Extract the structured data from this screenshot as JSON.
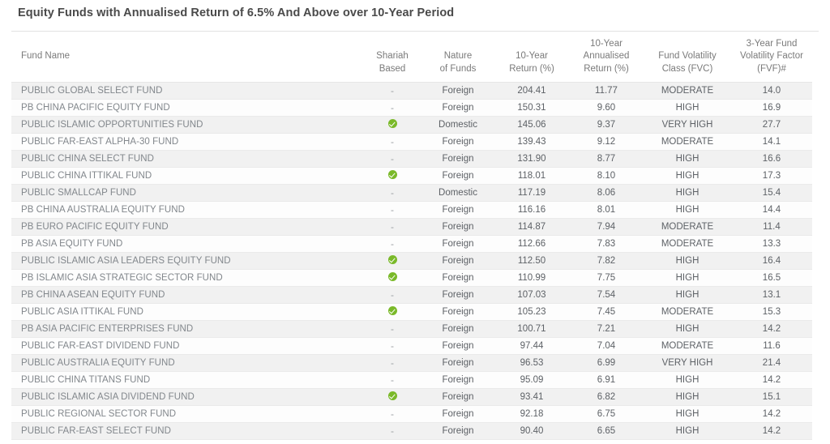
{
  "page": {
    "title": "Equity Funds with Annualised Return of 6.5% And Above over 10-Year Period"
  },
  "table": {
    "columns": [
      {
        "key": "name",
        "label": "Fund Name"
      },
      {
        "key": "shariah",
        "label": "Shariah\nBased"
      },
      {
        "key": "nature",
        "label": "Nature\nof Funds"
      },
      {
        "key": "ret10",
        "label": "10-Year\nReturn (%)"
      },
      {
        "key": "ann10",
        "label": "10-Year\nAnnualised\nReturn (%)"
      },
      {
        "key": "fvc",
        "label": "Fund Volatility\nClass (FVC)"
      },
      {
        "key": "fvf",
        "label": "3-Year Fund\nVolatility Factor\n(FVF)#"
      }
    ],
    "header": {
      "fund_name": "Fund Name",
      "shariah_line1": "Shariah",
      "shariah_line2": "Based",
      "nature_line1": "Nature",
      "nature_line2": "of Funds",
      "ret10_line1": "10-Year",
      "ret10_line2": "Return (%)",
      "ann10_line1": "10-Year",
      "ann10_line2": "Annualised",
      "ann10_line3": "Return (%)",
      "fvc_line1": "Fund Volatility",
      "fvc_line2": "Class (FVC)",
      "fvf_line1": "3-Year Fund",
      "fvf_line2": "Volatility Factor",
      "fvf_line3": "(FVF)#"
    },
    "icons": {
      "shariah_yes": "check-circle-icon",
      "shariah_no": "-"
    },
    "colors": {
      "check_green": "#7ab929",
      "row_odd": "#f1f1f1",
      "row_even": "#fdfdfd",
      "header_text": "#7a7a7a",
      "title_text": "#4a4a4a"
    },
    "rows": [
      {
        "name": "PUBLIC GLOBAL SELECT FUND",
        "shariah": false,
        "nature": "Foreign",
        "ret10": "204.41",
        "ann10": "11.77",
        "fvc": "MODERATE",
        "fvf": "14.0"
      },
      {
        "name": "PB CHINA PACIFIC EQUITY FUND",
        "shariah": false,
        "nature": "Foreign",
        "ret10": "150.31",
        "ann10": "9.60",
        "fvc": "HIGH",
        "fvf": "16.9"
      },
      {
        "name": "PUBLIC ISLAMIC OPPORTUNITIES FUND",
        "shariah": true,
        "nature": "Domestic",
        "ret10": "145.06",
        "ann10": "9.37",
        "fvc": "VERY HIGH",
        "fvf": "27.7"
      },
      {
        "name": "PUBLIC FAR-EAST ALPHA-30 FUND",
        "shariah": false,
        "nature": "Foreign",
        "ret10": "139.43",
        "ann10": "9.12",
        "fvc": "MODERATE",
        "fvf": "14.1"
      },
      {
        "name": "PUBLIC CHINA SELECT FUND",
        "shariah": false,
        "nature": "Foreign",
        "ret10": "131.90",
        "ann10": "8.77",
        "fvc": "HIGH",
        "fvf": "16.6"
      },
      {
        "name": "PUBLIC CHINA ITTIKAL FUND",
        "shariah": true,
        "nature": "Foreign",
        "ret10": "118.01",
        "ann10": "8.10",
        "fvc": "HIGH",
        "fvf": "17.3"
      },
      {
        "name": "PUBLIC SMALLCAP FUND",
        "shariah": false,
        "nature": "Domestic",
        "ret10": "117.19",
        "ann10": "8.06",
        "fvc": "HIGH",
        "fvf": "15.4"
      },
      {
        "name": "PB CHINA AUSTRALIA EQUITY FUND",
        "shariah": false,
        "nature": "Foreign",
        "ret10": "116.16",
        "ann10": "8.01",
        "fvc": "HIGH",
        "fvf": "14.4"
      },
      {
        "name": "PB EURO PACIFIC EQUITY FUND",
        "shariah": false,
        "nature": "Foreign",
        "ret10": "114.87",
        "ann10": "7.94",
        "fvc": "MODERATE",
        "fvf": "11.4"
      },
      {
        "name": "PB ASIA EQUITY FUND",
        "shariah": false,
        "nature": "Foreign",
        "ret10": "112.66",
        "ann10": "7.83",
        "fvc": "MODERATE",
        "fvf": "13.3"
      },
      {
        "name": "PUBLIC ISLAMIC ASIA LEADERS EQUITY FUND",
        "shariah": true,
        "nature": "Foreign",
        "ret10": "112.50",
        "ann10": "7.82",
        "fvc": "HIGH",
        "fvf": "16.4"
      },
      {
        "name": "PB ISLAMIC ASIA STRATEGIC SECTOR FUND",
        "shariah": true,
        "nature": "Foreign",
        "ret10": "110.99",
        "ann10": "7.75",
        "fvc": "HIGH",
        "fvf": "16.5"
      },
      {
        "name": "PB CHINA ASEAN EQUITY FUND",
        "shariah": false,
        "nature": "Foreign",
        "ret10": "107.03",
        "ann10": "7.54",
        "fvc": "HIGH",
        "fvf": "13.1"
      },
      {
        "name": "PUBLIC ASIA ITTIKAL FUND",
        "shariah": true,
        "nature": "Foreign",
        "ret10": "105.23",
        "ann10": "7.45",
        "fvc": "MODERATE",
        "fvf": "15.3"
      },
      {
        "name": "PB ASIA PACIFIC ENTERPRISES FUND",
        "shariah": false,
        "nature": "Foreign",
        "ret10": "100.71",
        "ann10": "7.21",
        "fvc": "HIGH",
        "fvf": "14.2"
      },
      {
        "name": "PUBLIC FAR-EAST DIVIDEND FUND",
        "shariah": false,
        "nature": "Foreign",
        "ret10": "97.44",
        "ann10": "7.04",
        "fvc": "MODERATE",
        "fvf": "11.6"
      },
      {
        "name": "PUBLIC AUSTRALIA EQUITY FUND",
        "shariah": false,
        "nature": "Foreign",
        "ret10": "96.53",
        "ann10": "6.99",
        "fvc": "VERY HIGH",
        "fvf": "21.4"
      },
      {
        "name": "PUBLIC CHINA TITANS FUND",
        "shariah": false,
        "nature": "Foreign",
        "ret10": "95.09",
        "ann10": "6.91",
        "fvc": "HIGH",
        "fvf": "14.2"
      },
      {
        "name": "PUBLIC ISLAMIC ASIA DIVIDEND FUND",
        "shariah": true,
        "nature": "Foreign",
        "ret10": "93.41",
        "ann10": "6.82",
        "fvc": "HIGH",
        "fvf": "15.1"
      },
      {
        "name": "PUBLIC REGIONAL SECTOR FUND",
        "shariah": false,
        "nature": "Foreign",
        "ret10": "92.18",
        "ann10": "6.75",
        "fvc": "HIGH",
        "fvf": "14.2"
      },
      {
        "name": "PUBLIC FAR-EAST SELECT FUND",
        "shariah": false,
        "nature": "Foreign",
        "ret10": "90.40",
        "ann10": "6.65",
        "fvc": "HIGH",
        "fvf": "14.2"
      }
    ]
  }
}
